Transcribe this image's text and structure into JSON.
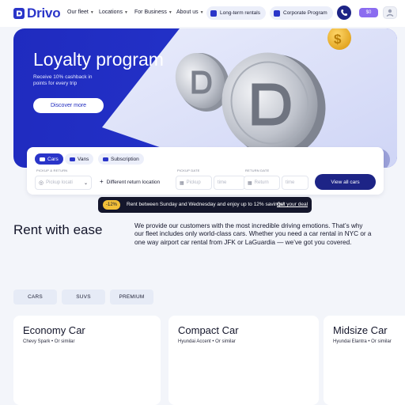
{
  "nav": {
    "brand": "Drivo",
    "links": [
      {
        "label": "Our fleet"
      },
      {
        "label": "Locations"
      },
      {
        "label": "For Business"
      },
      {
        "label": "About us"
      }
    ],
    "pills": [
      {
        "label": "Long-term rentals"
      },
      {
        "label": "Corporate Program"
      }
    ],
    "lang_badge": "$0",
    "colors": {
      "brand": "#2a35c9",
      "dark": "#1d2486",
      "lang": "#8b6cf0"
    }
  },
  "hero": {
    "title": "Loyalty program",
    "subtitle": "Receive 10% cashback in points for every trip",
    "button": "Discover more"
  },
  "booking": {
    "tabs": [
      {
        "label": "Cars",
        "active": true
      },
      {
        "label": "Vans",
        "active": false
      },
      {
        "label": "Subscription",
        "active": false
      }
    ],
    "pickup_return_label": "PICKUP & RETURN",
    "pickup_placeholder": "Pickup locati",
    "different_return": "Different return location",
    "pickup_date_label": "PICKUP DATE",
    "pickup_date_placeholder": "Pickup",
    "pickup_time_placeholder": "time",
    "return_date_label": "RETURN DATE",
    "return_date_placeholder": "Return",
    "return_time_placeholder": "time",
    "view_button": "View all cars"
  },
  "promo": {
    "badge": "-12%",
    "text": "Rent between Sunday and Wednesday and enjoy up to 12% savings!",
    "link": "Get your deal"
  },
  "rent": {
    "title": "Rent with ease",
    "description": "We provide our customers with the most incredible driving emotions. That’s why our fleet includes only world-class cars. Whether you need a car rental in NYC or a one way airport car rental from JFK or LaGuardia — we’ve got you covered."
  },
  "categories": [
    "CARS",
    "SUVS",
    "PREMIUM"
  ],
  "cars": [
    {
      "name": "Economy Car",
      "sub": "Chevy Spark • Or similar"
    },
    {
      "name": "Compact Car",
      "sub": "Hyundai Accent • Or similar"
    },
    {
      "name": "Midsize Car",
      "sub": "Hyundai Elantra • Or similar"
    }
  ]
}
